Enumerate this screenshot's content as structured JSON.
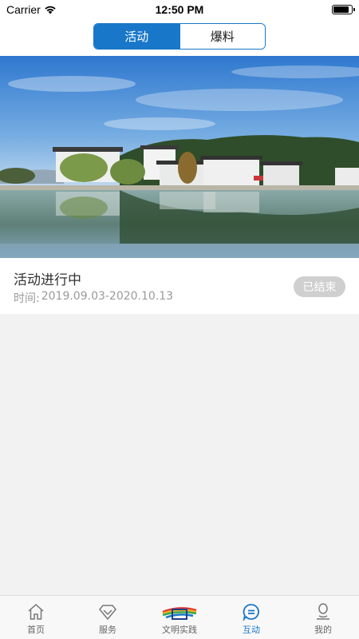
{
  "status_bar": {
    "carrier": "Carrier",
    "time": "12:50 PM",
    "battery_level": 0.9
  },
  "segments": [
    {
      "label": "活动",
      "active": true
    },
    {
      "label": "爆料",
      "active": false
    }
  ],
  "activity_card": {
    "title": "活动进行中",
    "time_label": "时间:",
    "time_range": "2019.09.03-2020.10.13",
    "status_badge": "已结束"
  },
  "tab_bar": [
    {
      "label": "首页",
      "icon": "home-icon",
      "active": false
    },
    {
      "label": "服务",
      "icon": "diamond-icon",
      "active": false
    },
    {
      "label": "文明实践",
      "icon": "civilization-logo-icon",
      "active": false
    },
    {
      "label": "互动",
      "icon": "chat-icon",
      "active": true
    },
    {
      "label": "我的",
      "icon": "user-icon",
      "active": false
    }
  ],
  "colors": {
    "accent": "#1877c9",
    "badge": "#cfcfcf",
    "background": "#f2f2f2"
  }
}
